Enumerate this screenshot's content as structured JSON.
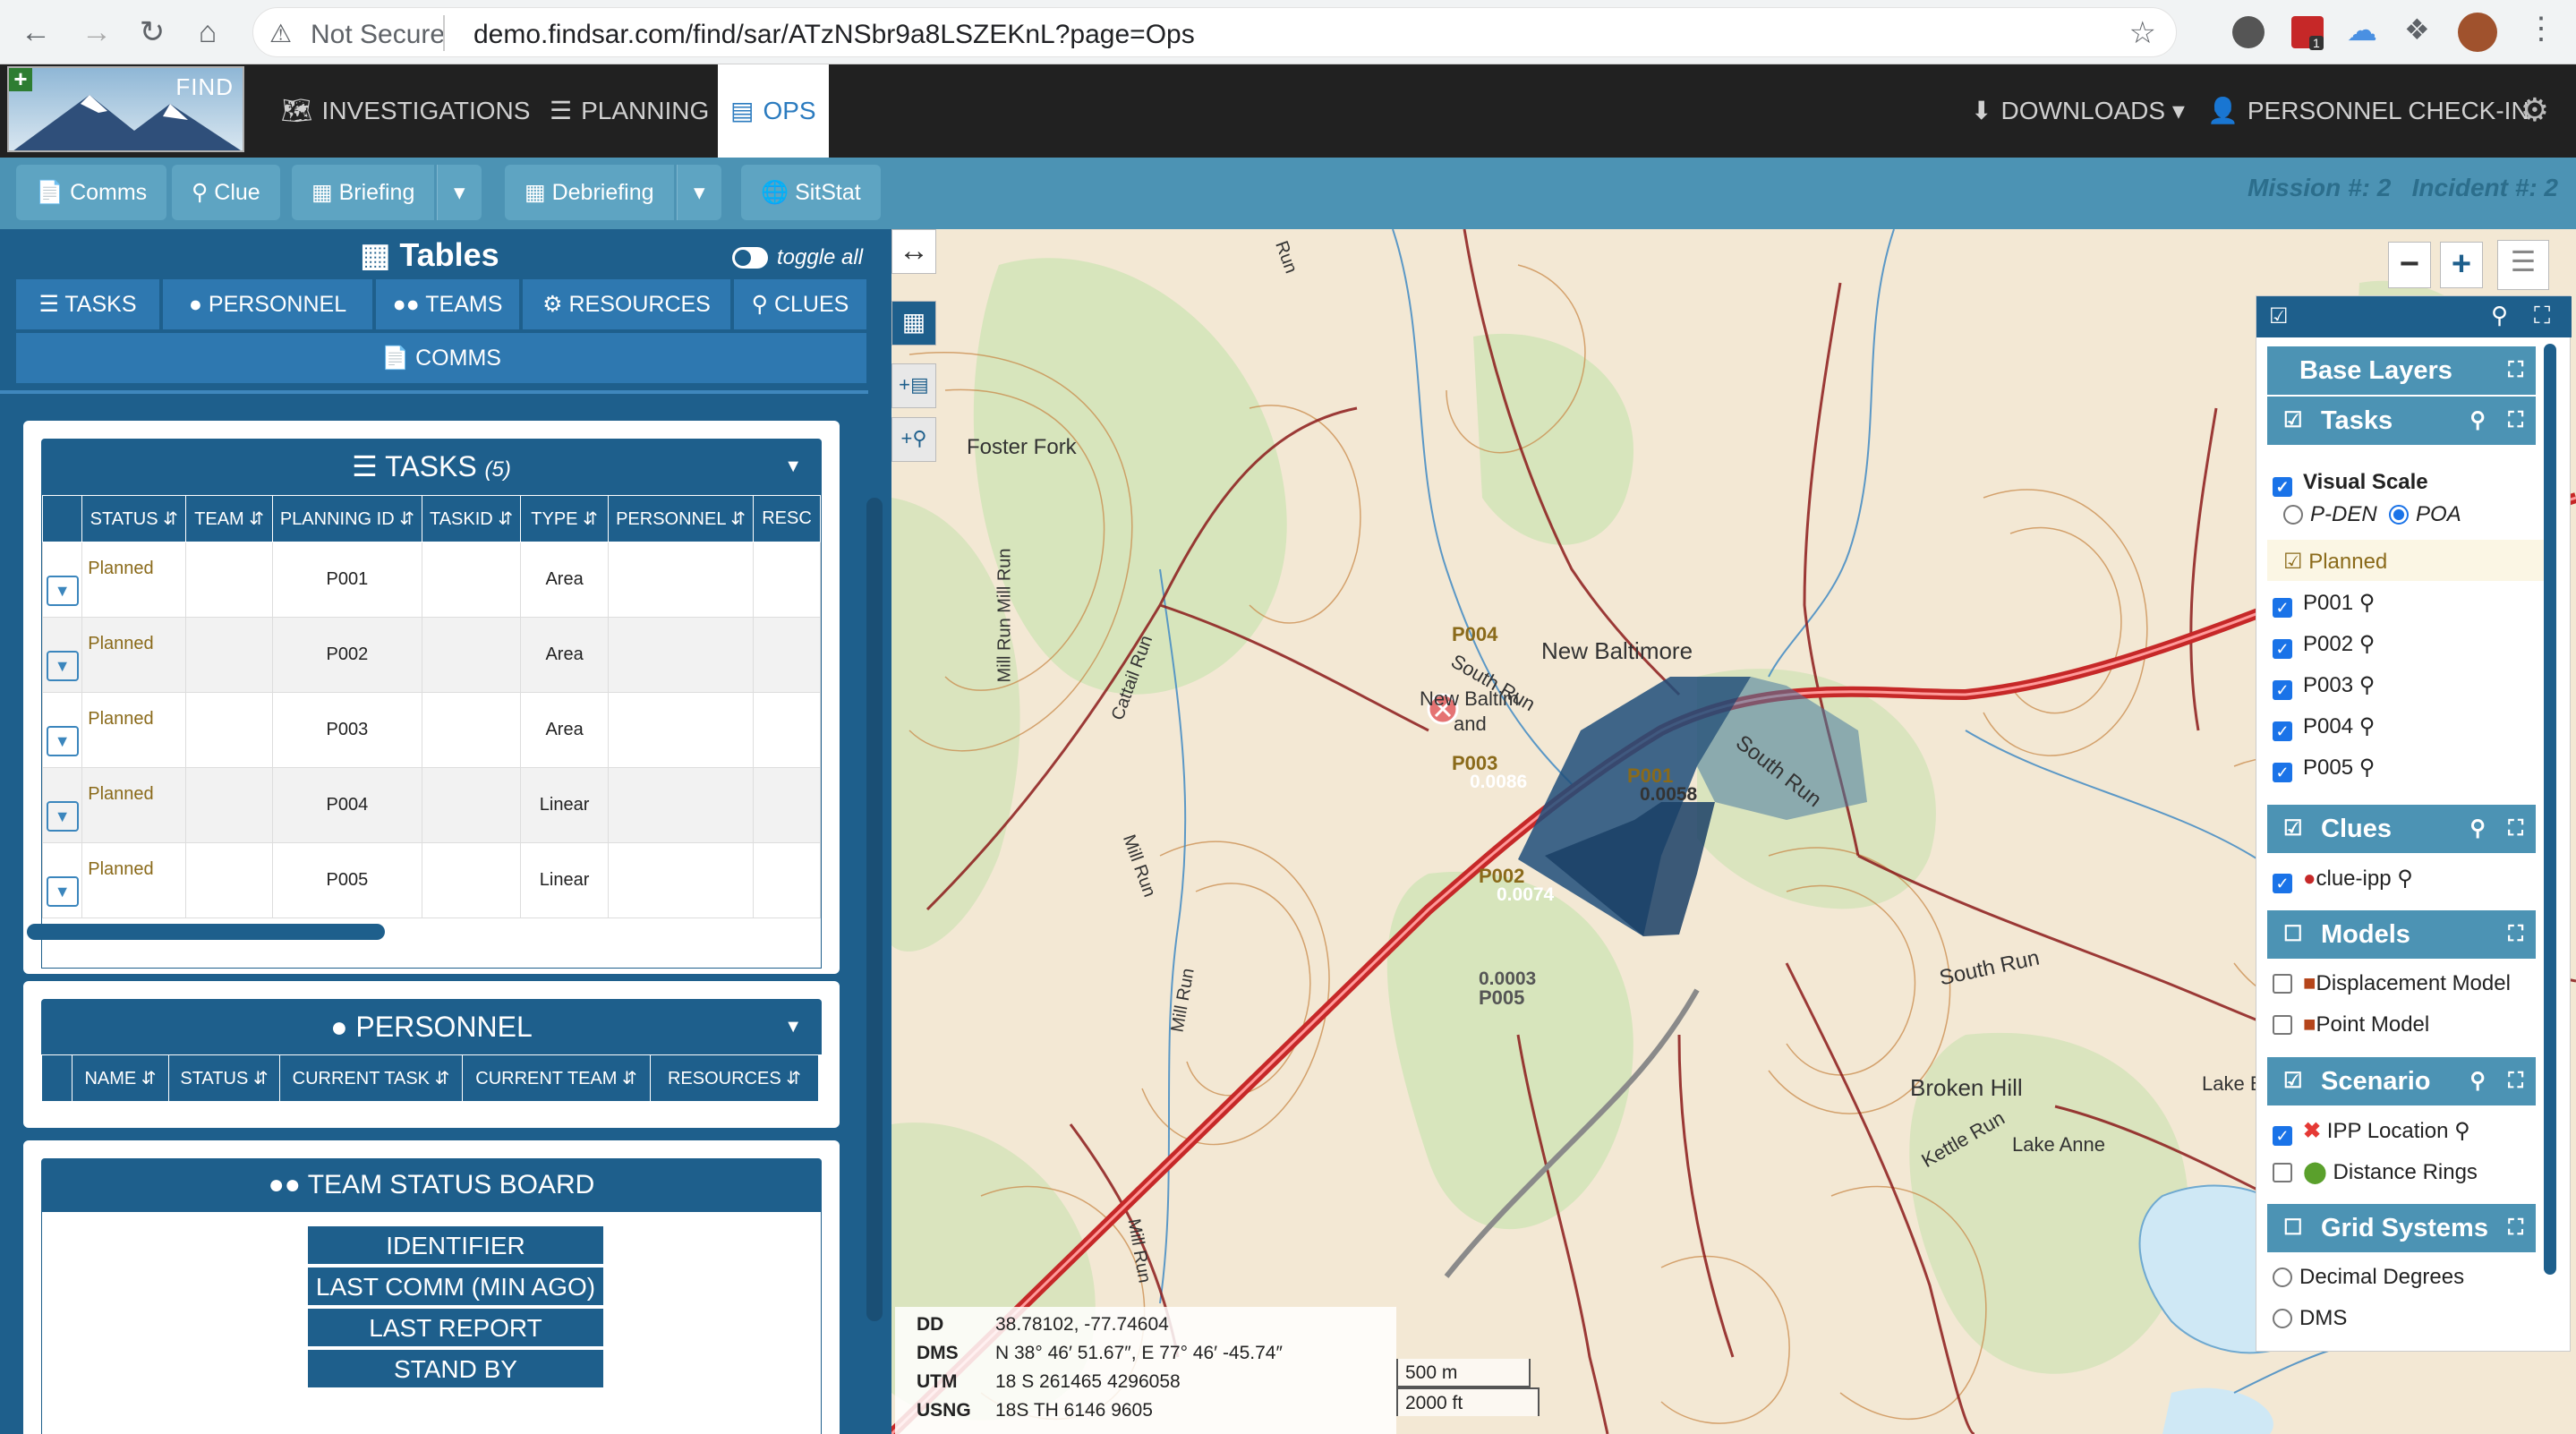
{
  "browser": {
    "not_secure": "Not Secure",
    "url": "demo.findsar.com/find/sar/ATzNSbr9a8LSZEKnL?page=Ops",
    "ext_badge": "1"
  },
  "header": {
    "logo_text": "FIND",
    "nav": {
      "investigations": "INVESTIGATIONS",
      "planning": "PLANNING",
      "ops": "OPS",
      "downloads": "DOWNLOADS",
      "checkin": "PERSONNEL CHECK-IN"
    }
  },
  "toolbar": {
    "comms": "Comms",
    "clue": "Clue",
    "briefing": "Briefing",
    "debriefing": "Debriefing",
    "sitstat": "SitStat",
    "mission": "Mission #: 2",
    "incident": "Incident #: 2"
  },
  "tables": {
    "title": "Tables",
    "toggle_all": "toggle all",
    "tabs": [
      "TASKS",
      "PERSONNEL",
      "TEAMS",
      "RESOURCES",
      "CLUES",
      "COMMS"
    ]
  },
  "tasks_table": {
    "title": "TASKS",
    "count": "(5)",
    "columns": [
      "STATUS",
      "TEAM",
      "PLANNING ID",
      "TASKID",
      "TYPE",
      "PERSONNEL",
      "RESC"
    ],
    "rows": [
      {
        "status": "Planned",
        "team": "",
        "planning_id": "P001",
        "taskid": "",
        "type": "Area",
        "personnel": ""
      },
      {
        "status": "Planned",
        "team": "",
        "planning_id": "P002",
        "taskid": "",
        "type": "Area",
        "personnel": ""
      },
      {
        "status": "Planned",
        "team": "",
        "planning_id": "P003",
        "taskid": "",
        "type": "Area",
        "personnel": ""
      },
      {
        "status": "Planned",
        "team": "",
        "planning_id": "P004",
        "taskid": "",
        "type": "Linear",
        "personnel": ""
      },
      {
        "status": "Planned",
        "team": "",
        "planning_id": "P005",
        "taskid": "",
        "type": "Linear",
        "personnel": ""
      }
    ]
  },
  "personnel_table": {
    "title": "PERSONNEL",
    "columns": [
      "NAME",
      "STATUS",
      "CURRENT TASK",
      "CURRENT TEAM",
      "RESOURCES"
    ]
  },
  "team_status": {
    "title": "TEAM STATUS BOARD",
    "rows": [
      "IDENTIFIER",
      "LAST COMM (MIN AGO)",
      "LAST REPORT",
      "STAND BY"
    ]
  },
  "map": {
    "labels": {
      "foster_fork": "Foster Fork",
      "new_baltimore": "New Baltimore",
      "new_baltimore_small": "New Baltim",
      "and": "and",
      "south_run": "South Run",
      "south_run_2": "South Run",
      "south_run_3": "South Run",
      "broken_hill": "Broken Hill",
      "kettle_run": "Kettle Run",
      "lake_anne": "Lake Anne",
      "lake_b": "Lake B",
      "mill_run_1": "Mill Run Mill Run",
      "mill_run_2": "Mill Run",
      "mill_run_3": "Mill Run",
      "mill_run_4": "Mill Run",
      "cattail_run": "Cattail Run",
      "run_top": "Run"
    },
    "polygons": {
      "p001": {
        "id": "P001",
        "poa": "0.0058"
      },
      "p002": {
        "id": "P002",
        "poa": "0.0074"
      },
      "p003": {
        "id": "P003",
        "poa": "0.0086"
      },
      "p004": {
        "id": "P004"
      },
      "p005": {
        "id": "P005",
        "poa": "0.0003"
      }
    },
    "coords": {
      "dd_label": "DD",
      "dd": "38.78102, -77.74604",
      "dms_label": "DMS",
      "dms": "N 38° 46′ 51.67″, E 77° 46′ -45.74″",
      "utm_label": "UTM",
      "utm": "18 S 261465 4296058",
      "usng_label": "USNG",
      "usng": "18S TH 6146 9605"
    },
    "scale_m": "500 m",
    "scale_ft": "2000 ft"
  },
  "layers": {
    "base_layers": "Base Layers",
    "tasks": "Tasks",
    "visual_scale": "Visual Scale",
    "pden": "P-DEN",
    "poa": "POA",
    "planned": "Planned",
    "task_items": [
      "P001",
      "P002",
      "P003",
      "P004",
      "P005"
    ],
    "clues": "Clues",
    "clue_ipp": "clue-ipp",
    "models": "Models",
    "displacement_model": "Displacement Model",
    "point_model": "Point Model",
    "scenario": "Scenario",
    "ipp_location": "IPP Location",
    "distance_rings": "Distance Rings",
    "grid_systems": "Grid Systems",
    "decimal_degrees": "Decimal Degrees",
    "dms": "DMS"
  },
  "colors": {
    "header_bg": "#212121",
    "toolbar_bg": "#4c93b4",
    "panel_bg": "#1e5f8c",
    "accent": "#2b7bbf",
    "road_red": "#c62828",
    "polygon_dark": "#1f4e7a",
    "status_planned": "#8a6a1a"
  }
}
